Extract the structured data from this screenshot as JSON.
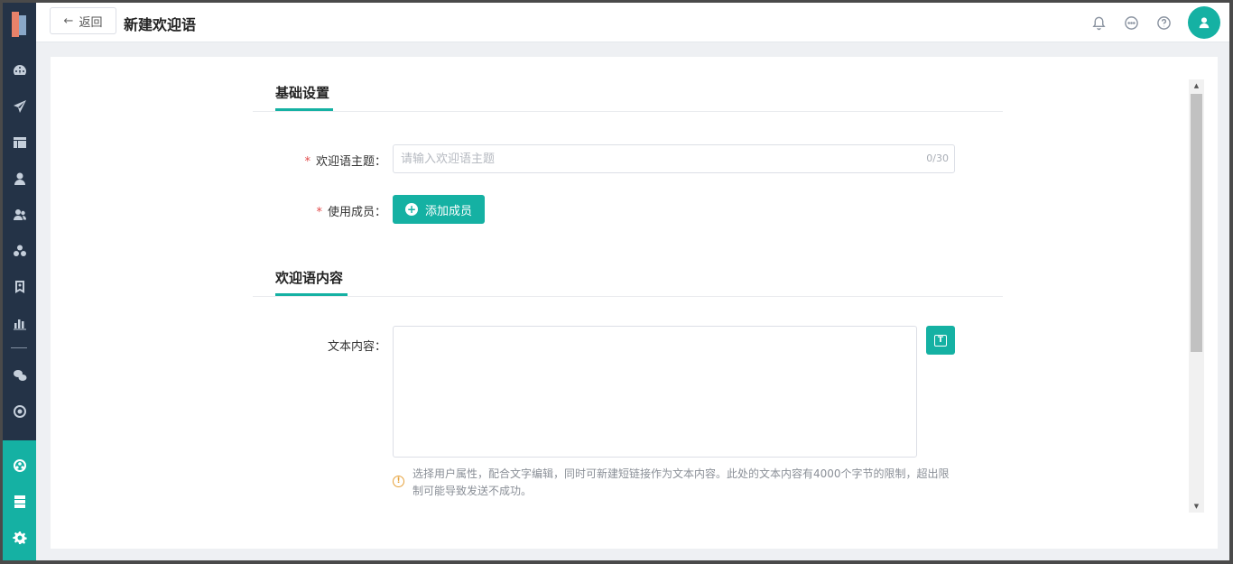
{
  "header": {
    "back_label": "返回",
    "title": "新建欢迎语"
  },
  "sidebar": {
    "items": [
      {
        "icon": "dashboard-icon"
      },
      {
        "icon": "send-icon"
      },
      {
        "icon": "layout-icon"
      },
      {
        "icon": "user-icon"
      },
      {
        "icon": "users-icon"
      },
      {
        "icon": "groups-icon"
      },
      {
        "icon": "bookmark-icon"
      },
      {
        "icon": "bar-chart-icon"
      },
      {
        "icon": "wechat-icon"
      },
      {
        "icon": "target-icon"
      }
    ],
    "bottom_items": [
      {
        "icon": "community-icon"
      },
      {
        "icon": "server-icon"
      },
      {
        "icon": "gear-icon"
      }
    ]
  },
  "form": {
    "section_basic": "基础设置",
    "topic_label": "欢迎语主题：",
    "topic_placeholder": "请输入欢迎语主题",
    "topic_value": "",
    "topic_count": "0/30",
    "members_label": "使用成员：",
    "add_member_label": "添加成员",
    "section_content": "欢迎语内容",
    "text_label": "文本内容：",
    "text_value": "",
    "hint": "选择用户属性，配合文字编辑，同时可新建短链接作为文本内容。此处的文本内容有4000个字节的限制，超出限制可能导致发送不成功。"
  },
  "colors": {
    "accent": "#15b1a3",
    "sidebar_bg": "#243347",
    "required": "#e24b4b",
    "warning": "#e6a23c"
  }
}
